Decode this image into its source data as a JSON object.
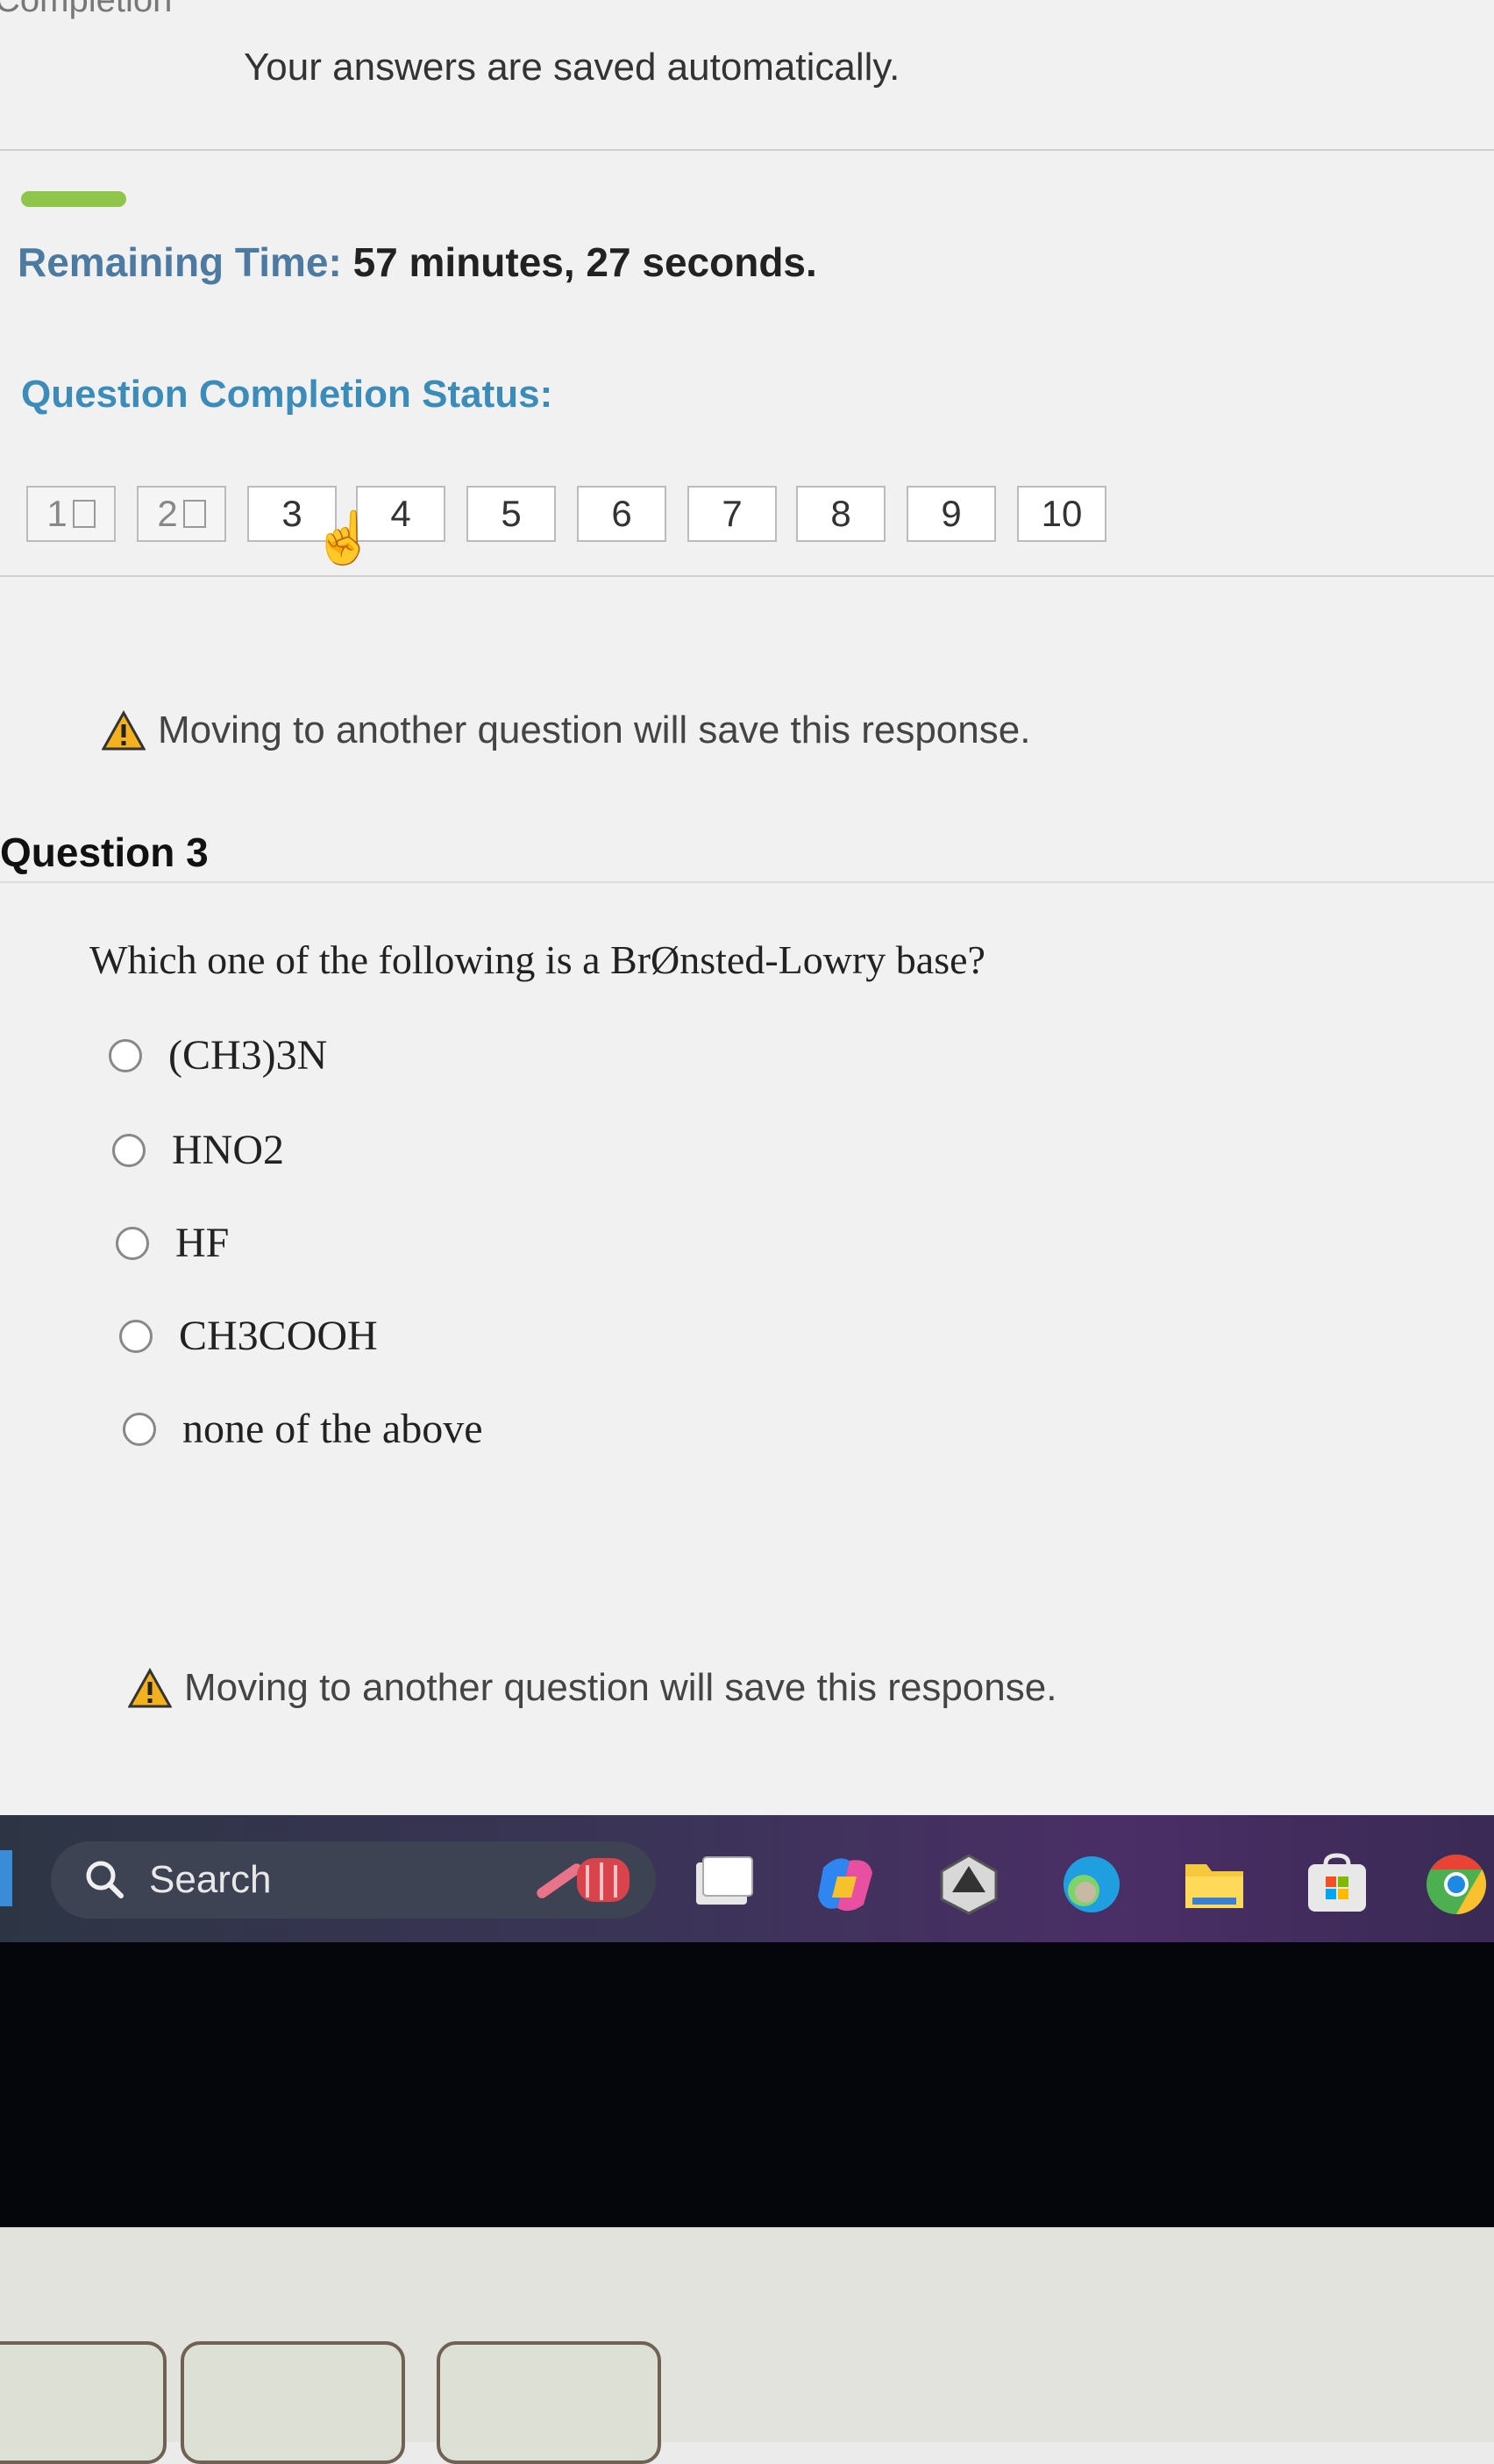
{
  "page": {
    "heading_partial": "Completion",
    "saved_note": "Your answers are saved automatically.",
    "progress_fraction": 0.1
  },
  "timer": {
    "label": "Remaining Time:",
    "value": "57 minutes, 27 seconds."
  },
  "status": {
    "label": "Question Completion Status:",
    "questions": [
      {
        "label": "1",
        "answered": true
      },
      {
        "label": "2",
        "answered": true
      },
      {
        "label": "3",
        "answered": false,
        "current": true
      },
      {
        "label": "4",
        "answered": false
      },
      {
        "label": "5",
        "answered": false
      },
      {
        "label": "6",
        "answered": false
      },
      {
        "label": "7",
        "answered": false
      },
      {
        "label": "8",
        "answered": false
      },
      {
        "label": "9",
        "answered": false
      },
      {
        "label": "10",
        "answered": false
      }
    ]
  },
  "warning_text": "Moving to another question will save this response.",
  "question": {
    "title": "Question 3",
    "text": "Which one of the following is a BrØnsted-Lowry base?",
    "options": [
      "(CH3)3N",
      "HNO2",
      "HF",
      "CH3COOH",
      "none of the above"
    ]
  },
  "taskbar": {
    "search_label": "Search",
    "icons": [
      "search-icon",
      "widgets-icon",
      "task-view-icon",
      "copilot-icon",
      "app-icon",
      "edge-icon",
      "file-explorer-icon",
      "store-icon",
      "chrome-icon"
    ],
    "accent_color": "#3a8bd8"
  },
  "colors": {
    "timer_label": "#4c7aa0",
    "status_label": "#3b8cb8",
    "progress": "#8fc54b",
    "warning": "#f2b11d"
  }
}
